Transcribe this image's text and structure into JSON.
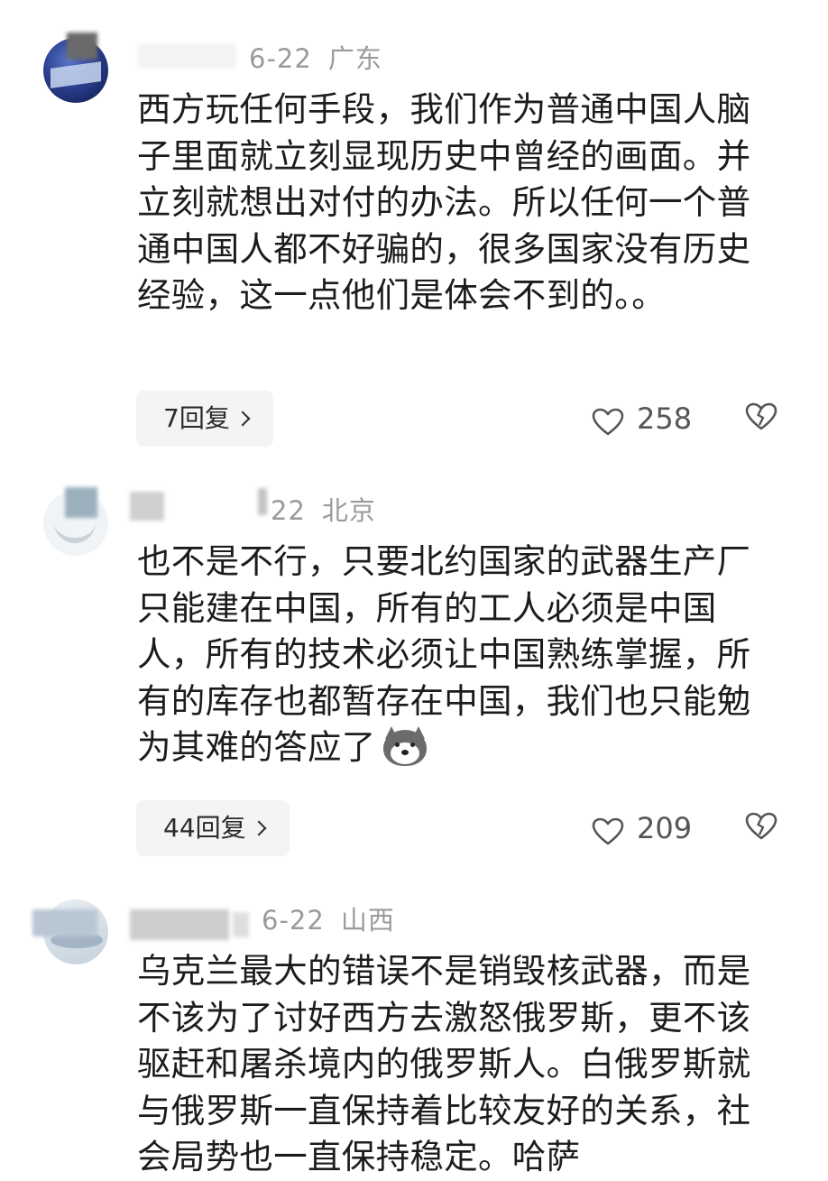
{
  "comments": [
    {
      "date": "6-22",
      "location": "广东",
      "text": "西方玩任何手段，我们作为普通中国人脑子里面就立刻显现历史中曾经的画面。并立刻就想出对付的办法。所以任何一个普通中国人都不好骗的，很多国家没有历史经验，这一点他们是体会不到的。。",
      "reply_label": "7回复",
      "likes": "258",
      "avatar_icon": "avatar-image",
      "like_icon": "heart-outline-icon",
      "dislike_icon": "broken-heart-icon"
    },
    {
      "date": "22",
      "location": "北京",
      "text": "也不是不行，只要北约国家的武器生产厂只能建在中国，所有的工人必须是中国人，所有的技术必须让中国熟练掌握，所有的库存也都暂存在中国，我们也只能勉为其难的答应了",
      "emoji": "husky-dog-emoji",
      "reply_label": "44回复",
      "likes": "209",
      "avatar_icon": "avatar-image",
      "like_icon": "heart-outline-icon",
      "dislike_icon": "broken-heart-icon"
    },
    {
      "date": "6-22",
      "location": "山西",
      "text": "乌克兰最大的错误不是销毁核武器，而是不该为了讨好西方去激怒俄罗斯，更不该驱赶和屠杀境内的俄罗斯人。白俄罗斯就与俄罗斯一直保持着比较友好的关系，社会局势也一直保持稳定。哈萨",
      "avatar_icon": "avatar-image"
    }
  ],
  "colors": {
    "text": "#1c1c1c",
    "meta": "#9a9a9a",
    "reply_bg": "#f4f4f4",
    "icon": "#555555"
  }
}
